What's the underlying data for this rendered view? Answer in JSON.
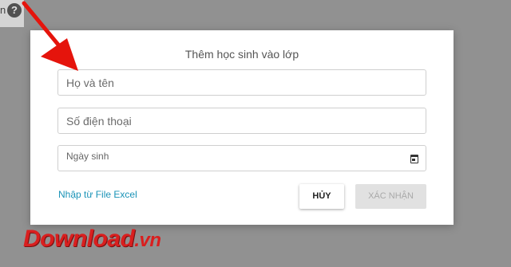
{
  "background": {
    "partial_text": "n",
    "help_icon": "question-circle-icon"
  },
  "modal": {
    "title": "Thêm học sinh vào lớp",
    "fields": {
      "fullname_placeholder": "Họ và tên",
      "phone_placeholder": "Số điện thoại",
      "birthdate_placeholder": "Ngày sinh",
      "birthdate_icon": "calendar-icon"
    },
    "import_link": "Nhập từ File Excel",
    "cancel_label": "HỦY",
    "confirm_label": "XÁC NHẬN"
  },
  "watermark": {
    "main": "Download",
    "tld": ".vn"
  },
  "colors": {
    "overlay": "#919191",
    "link": "#1a93b7",
    "arrow": "#e5140c",
    "watermark": "#d91f1f"
  }
}
